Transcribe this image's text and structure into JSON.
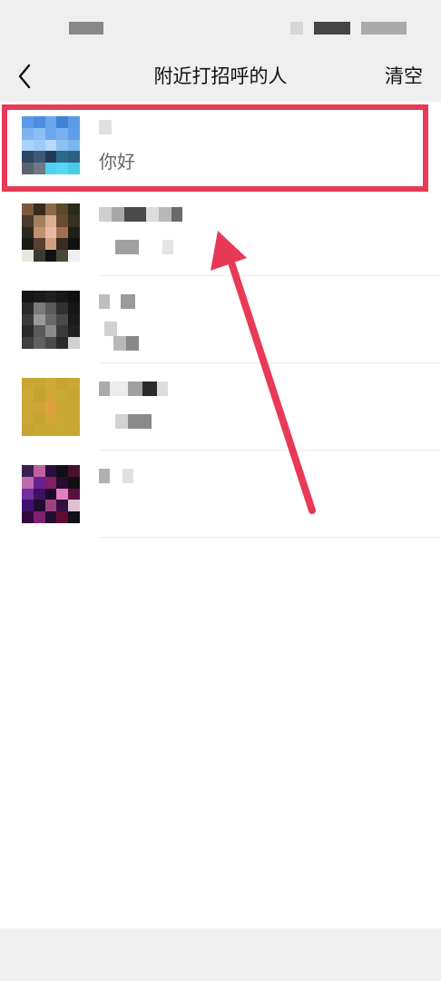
{
  "nav": {
    "back_icon": "chevron-left-icon",
    "title": "附近打招呼的人",
    "clear_label": "清空"
  },
  "greetings": [
    {
      "message": "你好"
    },
    {
      "message": ""
    },
    {
      "message": ""
    },
    {
      "message": ""
    },
    {
      "message": ""
    }
  ],
  "annotation": {
    "highlight_color": "#e83a57",
    "arrow_color": "#e83a57"
  }
}
